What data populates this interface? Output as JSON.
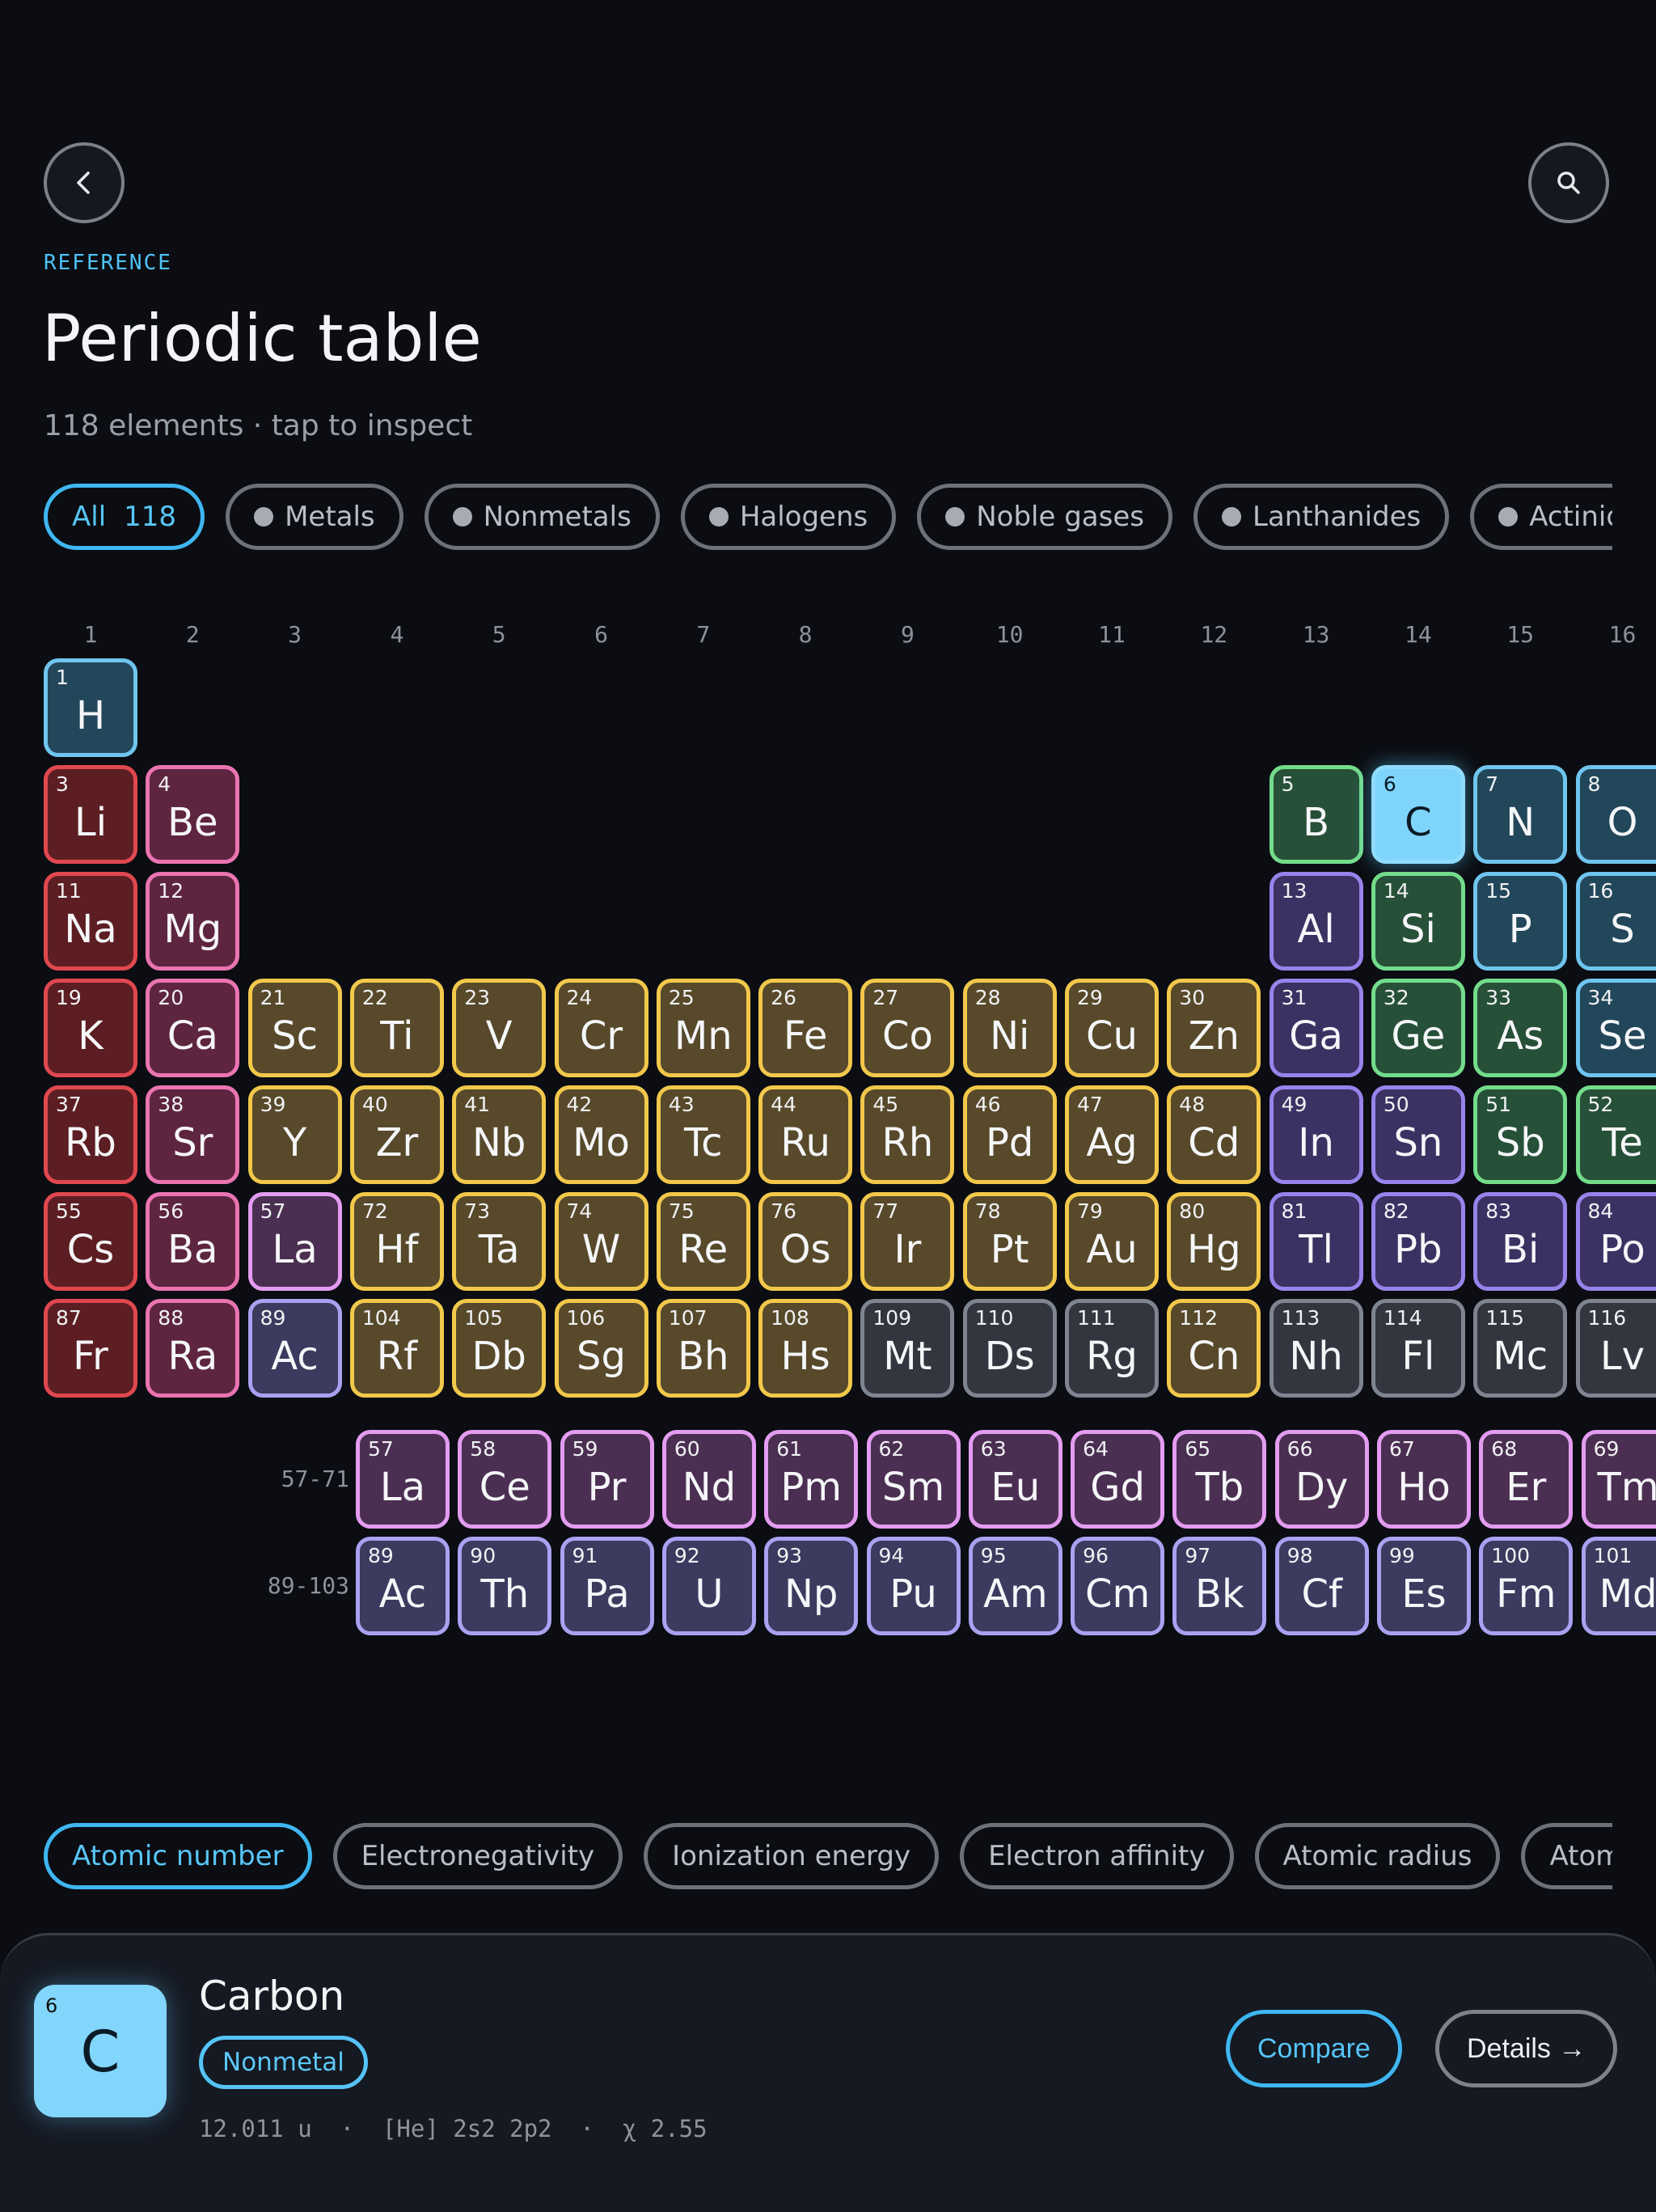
{
  "header": {
    "eyebrow": "REFERENCE",
    "title": "Periodic table",
    "subtitle": "118 elements · tap to inspect"
  },
  "filters": [
    {
      "label": "All",
      "count": "118",
      "active": true
    },
    {
      "label": "Metals",
      "dot": true
    },
    {
      "label": "Nonmetals",
      "dot": true
    },
    {
      "label": "Halogens",
      "dot": true
    },
    {
      "label": "Noble gases",
      "dot": true
    },
    {
      "label": "Lanthanides",
      "dot": true
    },
    {
      "label": "Actinides",
      "dot": true
    }
  ],
  "groups": [
    "1",
    "2",
    "3",
    "4",
    "5",
    "6",
    "7",
    "8",
    "9",
    "10",
    "11",
    "12",
    "13",
    "14",
    "15",
    "16"
  ],
  "colors": {
    "accent": "#4fc3f7",
    "alkali": "#e0484f",
    "alkaline": "#ea74b1",
    "transition": "#f2c84b",
    "post": "#9783ea",
    "metalloid": "#73dc8b",
    "nonmetal": "#6fc5ee",
    "unknown": "#7e8591",
    "lanth": "#e39cf1",
    "actin": "#aaa1f1"
  },
  "main_rows": [
    [
      {
        "n": "1",
        "s": "H",
        "c": "nonmetal",
        "col": 1
      }
    ],
    [
      {
        "n": "3",
        "s": "Li",
        "c": "alkali",
        "col": 1
      },
      {
        "n": "4",
        "s": "Be",
        "c": "alkaline",
        "col": 2
      },
      {
        "n": "5",
        "s": "B",
        "c": "metalloid",
        "col": 13
      },
      {
        "n": "6",
        "s": "C",
        "c": "selected",
        "col": 14
      },
      {
        "n": "7",
        "s": "N",
        "c": "nonmetal",
        "col": 15
      },
      {
        "n": "8",
        "s": "O",
        "c": "nonmetal",
        "col": 16
      }
    ],
    [
      {
        "n": "11",
        "s": "Na",
        "c": "alkali",
        "col": 1
      },
      {
        "n": "12",
        "s": "Mg",
        "c": "alkaline",
        "col": 2
      },
      {
        "n": "13",
        "s": "Al",
        "c": "post",
        "col": 13
      },
      {
        "n": "14",
        "s": "Si",
        "c": "metalloid",
        "col": 14
      },
      {
        "n": "15",
        "s": "P",
        "c": "nonmetal",
        "col": 15
      },
      {
        "n": "16",
        "s": "S",
        "c": "nonmetal",
        "col": 16
      }
    ],
    [
      {
        "n": "19",
        "s": "K",
        "c": "alkali",
        "col": 1
      },
      {
        "n": "20",
        "s": "Ca",
        "c": "alkaline",
        "col": 2
      },
      {
        "n": "21",
        "s": "Sc",
        "c": "transition",
        "col": 3
      },
      {
        "n": "22",
        "s": "Ti",
        "c": "transition",
        "col": 4
      },
      {
        "n": "23",
        "s": "V",
        "c": "transition",
        "col": 5
      },
      {
        "n": "24",
        "s": "Cr",
        "c": "transition",
        "col": 6
      },
      {
        "n": "25",
        "s": "Mn",
        "c": "transition",
        "col": 7
      },
      {
        "n": "26",
        "s": "Fe",
        "c": "transition",
        "col": 8
      },
      {
        "n": "27",
        "s": "Co",
        "c": "transition",
        "col": 9
      },
      {
        "n": "28",
        "s": "Ni",
        "c": "transition",
        "col": 10
      },
      {
        "n": "29",
        "s": "Cu",
        "c": "transition",
        "col": 11
      },
      {
        "n": "30",
        "s": "Zn",
        "c": "transition",
        "col": 12
      },
      {
        "n": "31",
        "s": "Ga",
        "c": "post",
        "col": 13
      },
      {
        "n": "32",
        "s": "Ge",
        "c": "metalloid",
        "col": 14
      },
      {
        "n": "33",
        "s": "As",
        "c": "metalloid",
        "col": 15
      },
      {
        "n": "34",
        "s": "Se",
        "c": "nonmetal",
        "col": 16
      }
    ],
    [
      {
        "n": "37",
        "s": "Rb",
        "c": "alkali",
        "col": 1
      },
      {
        "n": "38",
        "s": "Sr",
        "c": "alkaline",
        "col": 2
      },
      {
        "n": "39",
        "s": "Y",
        "c": "transition",
        "col": 3
      },
      {
        "n": "40",
        "s": "Zr",
        "c": "transition",
        "col": 4
      },
      {
        "n": "41",
        "s": "Nb",
        "c": "transition",
        "col": 5
      },
      {
        "n": "42",
        "s": "Mo",
        "c": "transition",
        "col": 6
      },
      {
        "n": "43",
        "s": "Tc",
        "c": "transition",
        "col": 7
      },
      {
        "n": "44",
        "s": "Ru",
        "c": "transition",
        "col": 8
      },
      {
        "n": "45",
        "s": "Rh",
        "c": "transition",
        "col": 9
      },
      {
        "n": "46",
        "s": "Pd",
        "c": "transition",
        "col": 10
      },
      {
        "n": "47",
        "s": "Ag",
        "c": "transition",
        "col": 11
      },
      {
        "n": "48",
        "s": "Cd",
        "c": "transition",
        "col": 12
      },
      {
        "n": "49",
        "s": "In",
        "c": "post",
        "col": 13
      },
      {
        "n": "50",
        "s": "Sn",
        "c": "post",
        "col": 14
      },
      {
        "n": "51",
        "s": "Sb",
        "c": "metalloid",
        "col": 15
      },
      {
        "n": "52",
        "s": "Te",
        "c": "metalloid",
        "col": 16
      }
    ],
    [
      {
        "n": "55",
        "s": "Cs",
        "c": "alkali",
        "col": 1
      },
      {
        "n": "56",
        "s": "Ba",
        "c": "alkaline",
        "col": 2
      },
      {
        "n": "57",
        "s": "La",
        "c": "lanth",
        "col": 3
      },
      {
        "n": "72",
        "s": "Hf",
        "c": "transition",
        "col": 4
      },
      {
        "n": "73",
        "s": "Ta",
        "c": "transition",
        "col": 5
      },
      {
        "n": "74",
        "s": "W",
        "c": "transition",
        "col": 6
      },
      {
        "n": "75",
        "s": "Re",
        "c": "transition",
        "col": 7
      },
      {
        "n": "76",
        "s": "Os",
        "c": "transition",
        "col": 8
      },
      {
        "n": "77",
        "s": "Ir",
        "c": "transition",
        "col": 9
      },
      {
        "n": "78",
        "s": "Pt",
        "c": "transition",
        "col": 10
      },
      {
        "n": "79",
        "s": "Au",
        "c": "transition",
        "col": 11
      },
      {
        "n": "80",
        "s": "Hg",
        "c": "transition",
        "col": 12
      },
      {
        "n": "81",
        "s": "Tl",
        "c": "post",
        "col": 13
      },
      {
        "n": "82",
        "s": "Pb",
        "c": "post",
        "col": 14
      },
      {
        "n": "83",
        "s": "Bi",
        "c": "post",
        "col": 15
      },
      {
        "n": "84",
        "s": "Po",
        "c": "post",
        "col": 16
      }
    ],
    [
      {
        "n": "87",
        "s": "Fr",
        "c": "alkali",
        "col": 1
      },
      {
        "n": "88",
        "s": "Ra",
        "c": "alkaline",
        "col": 2
      },
      {
        "n": "89",
        "s": "Ac",
        "c": "actin",
        "col": 3
      },
      {
        "n": "104",
        "s": "Rf",
        "c": "transition",
        "col": 4
      },
      {
        "n": "105",
        "s": "Db",
        "c": "transition",
        "col": 5
      },
      {
        "n": "106",
        "s": "Sg",
        "c": "transition",
        "col": 6
      },
      {
        "n": "107",
        "s": "Bh",
        "c": "transition",
        "col": 7
      },
      {
        "n": "108",
        "s": "Hs",
        "c": "transition",
        "col": 8
      },
      {
        "n": "109",
        "s": "Mt",
        "c": "unknown",
        "col": 9
      },
      {
        "n": "110",
        "s": "Ds",
        "c": "unknown",
        "col": 10
      },
      {
        "n": "111",
        "s": "Rg",
        "c": "unknown",
        "col": 11
      },
      {
        "n": "112",
        "s": "Cn",
        "c": "transition",
        "col": 12
      },
      {
        "n": "113",
        "s": "Nh",
        "c": "unknown",
        "col": 13
      },
      {
        "n": "114",
        "s": "Fl",
        "c": "unknown",
        "col": 14
      },
      {
        "n": "115",
        "s": "Mc",
        "c": "unknown",
        "col": 15
      },
      {
        "n": "116",
        "s": "Lv",
        "c": "unknown",
        "col": 16
      }
    ]
  ],
  "series": [
    {
      "label": "57-71",
      "cls": "lanth",
      "elements": [
        [
          "57",
          "La"
        ],
        [
          "58",
          "Ce"
        ],
        [
          "59",
          "Pr"
        ],
        [
          "60",
          "Nd"
        ],
        [
          "61",
          "Pm"
        ],
        [
          "62",
          "Sm"
        ],
        [
          "63",
          "Eu"
        ],
        [
          "64",
          "Gd"
        ],
        [
          "65",
          "Tb"
        ],
        [
          "66",
          "Dy"
        ],
        [
          "67",
          "Ho"
        ],
        [
          "68",
          "Er"
        ],
        [
          "69",
          "Tm"
        ]
      ]
    },
    {
      "label": "89-103",
      "cls": "actin",
      "elements": [
        [
          "89",
          "Ac"
        ],
        [
          "90",
          "Th"
        ],
        [
          "91",
          "Pa"
        ],
        [
          "92",
          "U"
        ],
        [
          "93",
          "Np"
        ],
        [
          "94",
          "Pu"
        ],
        [
          "95",
          "Am"
        ],
        [
          "96",
          "Cm"
        ],
        [
          "97",
          "Bk"
        ],
        [
          "98",
          "Cf"
        ],
        [
          "99",
          "Es"
        ],
        [
          "100",
          "Fm"
        ],
        [
          "101",
          "Md"
        ]
      ]
    }
  ],
  "properties": [
    {
      "label": "Atomic number",
      "active": true
    },
    {
      "label": "Electronegativity"
    },
    {
      "label": "Ionization energy"
    },
    {
      "label": "Electron affinity"
    },
    {
      "label": "Atomic radius"
    },
    {
      "label": "Atomic ma"
    }
  ],
  "selected": {
    "number": "6",
    "symbol": "C",
    "name": "Carbon",
    "category": "Nonmetal",
    "meta": "12.011 u  ·  [He] 2s2 2p2  ·  χ 2.55",
    "compare_label": "Compare",
    "details_label": "Details →"
  }
}
